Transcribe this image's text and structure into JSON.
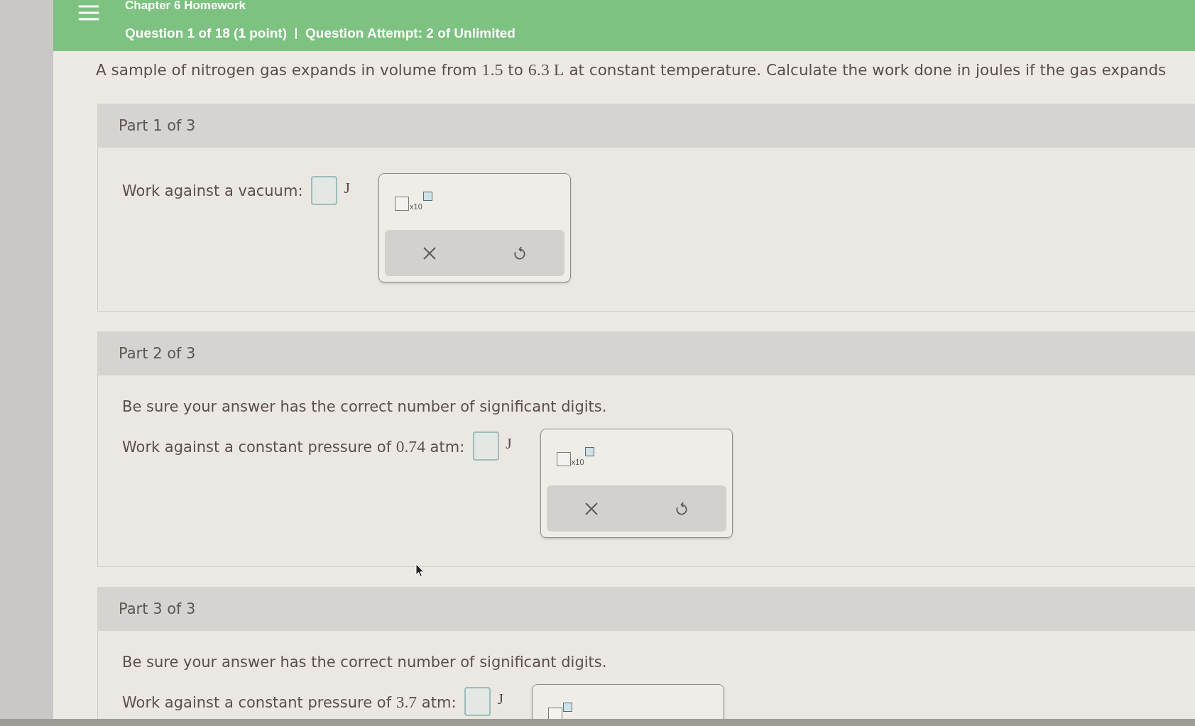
{
  "header": {
    "assignment": "Chapter 6 Homework",
    "question": "Question 1 of 18 (1 point)",
    "attempt": "Question Attempt: 2 of Unlimited"
  },
  "question": {
    "segments": [
      {
        "kind": "text",
        "text": "A sample of nitrogen gas expands in volume from "
      },
      {
        "kind": "math",
        "text": "1.5"
      },
      {
        "kind": "text",
        "text": " to "
      },
      {
        "kind": "math",
        "text": "6.3 L"
      },
      {
        "kind": "text",
        "text": " at constant temperature. Calculate the work done in joules if the gas expands"
      }
    ]
  },
  "parts": [
    {
      "title": "Part 1 of 3",
      "answer": {
        "segments": [
          {
            "kind": "text",
            "text": "Work against a vacuum:"
          }
        ],
        "unit": "J"
      },
      "palette": {
        "template": "x10",
        "tools": [
          {
            "kind": "clear"
          },
          {
            "kind": "undo"
          }
        ]
      }
    },
    {
      "title": "Part 2 of 3",
      "note": "Be sure your answer has the correct number of significant digits.",
      "answer": {
        "segments": [
          {
            "kind": "text",
            "text": "Work against a constant pressure of "
          },
          {
            "kind": "math",
            "text": "0.74"
          },
          {
            "kind": "text",
            "text": " atm:"
          }
        ],
        "unit": "J"
      },
      "palette": {
        "template": "x10",
        "tools": [
          {
            "kind": "clear"
          },
          {
            "kind": "undo"
          }
        ]
      }
    },
    {
      "title": "Part 3 of 3",
      "note": "Be sure your answer has the correct number of significant digits.",
      "answer": {
        "segments": [
          {
            "kind": "text",
            "text": "Work against a constant pressure of "
          },
          {
            "kind": "math",
            "text": "3.7"
          },
          {
            "kind": "text",
            "text": " atm:"
          }
        ],
        "unit": "J"
      }
    }
  ]
}
